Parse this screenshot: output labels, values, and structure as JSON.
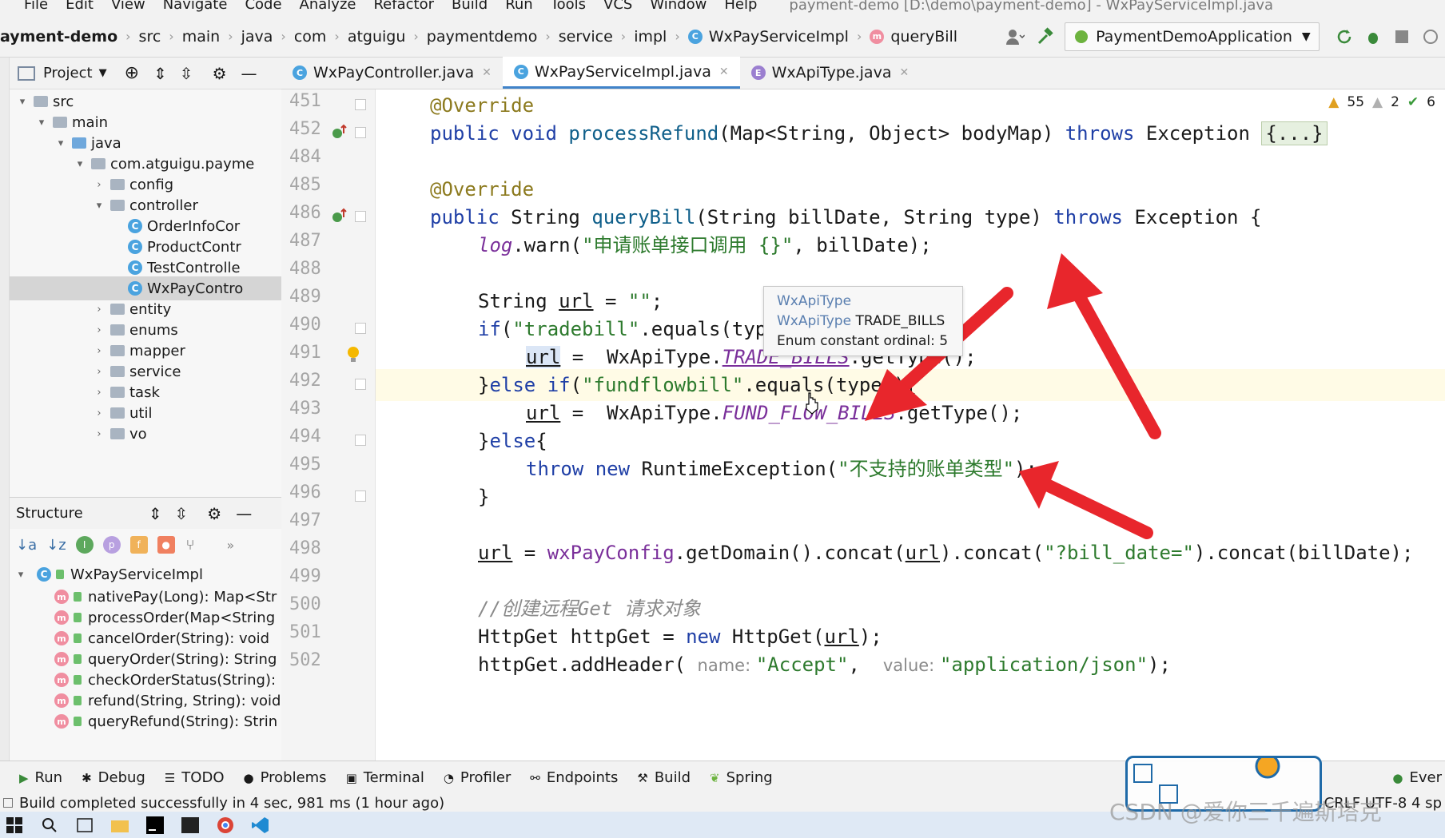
{
  "menu": [
    "File",
    "Edit",
    "View",
    "Navigate",
    "Code",
    "Analyze",
    "Refactor",
    "Build",
    "Run",
    "Tools",
    "VCS",
    "Window",
    "Help"
  ],
  "window_title": "payment-demo [D:\\demo\\payment-demo] - WxPayServiceImpl.java",
  "breadcrumb": [
    "ayment-demo",
    "src",
    "main",
    "java",
    "com",
    "atguigu",
    "paymentdemo",
    "service",
    "impl",
    "WxPayServiceImpl",
    "queryBill"
  ],
  "run_config": "PaymentDemoApplication",
  "project_panel": {
    "title": "Project",
    "tree": [
      {
        "label": "src",
        "depth": 1,
        "arrow": "▾",
        "kind": "folder"
      },
      {
        "label": "main",
        "depth": 2,
        "arrow": "▾",
        "kind": "folder"
      },
      {
        "label": "java",
        "depth": 3,
        "arrow": "▾",
        "kind": "folder-blue"
      },
      {
        "label": "com.atguigu.payme",
        "depth": 4,
        "arrow": "▾",
        "kind": "folder"
      },
      {
        "label": "config",
        "depth": 5,
        "arrow": "›",
        "kind": "folder"
      },
      {
        "label": "controller",
        "depth": 5,
        "arrow": "▾",
        "kind": "folder"
      },
      {
        "label": "OrderInfoCor",
        "depth": 6,
        "arrow": "",
        "kind": "class"
      },
      {
        "label": "ProductContr",
        "depth": 6,
        "arrow": "",
        "kind": "class"
      },
      {
        "label": "TestControlle",
        "depth": 6,
        "arrow": "",
        "kind": "class"
      },
      {
        "label": "WxPayContro",
        "depth": 6,
        "arrow": "",
        "kind": "class",
        "selected": true
      },
      {
        "label": "entity",
        "depth": 5,
        "arrow": "›",
        "kind": "folder"
      },
      {
        "label": "enums",
        "depth": 5,
        "arrow": "›",
        "kind": "folder"
      },
      {
        "label": "mapper",
        "depth": 5,
        "arrow": "›",
        "kind": "folder"
      },
      {
        "label": "service",
        "depth": 5,
        "arrow": "›",
        "kind": "folder"
      },
      {
        "label": "task",
        "depth": 5,
        "arrow": "›",
        "kind": "folder"
      },
      {
        "label": "util",
        "depth": 5,
        "arrow": "›",
        "kind": "folder"
      },
      {
        "label": "vo",
        "depth": 5,
        "arrow": "›",
        "kind": "folder"
      }
    ]
  },
  "structure_panel": {
    "title": "Structure",
    "root": "WxPayServiceImpl",
    "members": [
      "nativePay(Long): Map<Str",
      "processOrder(Map<String",
      "cancelOrder(String): void",
      "queryOrder(String): String",
      "checkOrderStatus(String):",
      "refund(String, String): void",
      "queryRefund(String): Strin"
    ]
  },
  "tabs": [
    {
      "label": "WxPayController.java",
      "icon": "C",
      "active": false
    },
    {
      "label": "WxPayServiceImpl.java",
      "icon": "C",
      "active": true
    },
    {
      "label": "WxApiType.java",
      "icon": "E",
      "active": false
    }
  ],
  "inspections": {
    "warnings": "55",
    "weak": "2",
    "ok": "6"
  },
  "line_numbers": [
    "451",
    "452",
    "484",
    "485",
    "486",
    "487",
    "488",
    "489",
    "490",
    "491",
    "492",
    "493",
    "494",
    "495",
    "496",
    "497",
    "498",
    "499",
    "500",
    "501",
    "502"
  ],
  "tooltip": {
    "line1": "WxApiType",
    "line2": "WxApiType TRADE_BILLS",
    "line3": "Enum constant ordinal: 5"
  },
  "code": {
    "l451": "@Override",
    "l452_kw": "public void ",
    "l452_fn": "processRefund",
    "l452_rest": "(Map<String, Object> bodyMap) ",
    "l452_throws": "throws",
    "l452_exc": " Exception ",
    "l452_fold": "{...}",
    "l485": "@Override",
    "l486_kw": "public ",
    "l486_type": "String ",
    "l486_fn": "queryBill",
    "l486_rest": "(String billDate, String type) ",
    "l486_throws": "throws",
    "l486_exc": " Exception {",
    "l487_log": "log",
    "l487_mid": ".warn(",
    "l487_str": "\"申请账单接口调用 {}\"",
    "l487_end": ", billDate);",
    "l489_a": "String ",
    "l489_var": "url",
    "l489_b": " = ",
    "l489_str": "\"\"",
    "l489_c": ";",
    "l490_kw": "if",
    "l490_a": "(",
    "l490_str": "\"tradebill\"",
    "l490_b": ".equals(type)){",
    "l491_var": "url",
    "l491_a": " =  WxApiType.",
    "l491_fld": "TRADE_BILLS",
    "l491_b": ".getType();",
    "l492_a": "}",
    "l492_kw": "else if",
    "l492_b": "(",
    "l492_str": "\"fundflowbill\"",
    "l492_c": ".equals(type)){",
    "l493_var": "url",
    "l493_a": " =  WxApiType.",
    "l493_fld": "FUND_FLOW_BILLS",
    "l493_b": ".getType();",
    "l494_a": "}",
    "l494_kw": "else",
    "l494_b": "{",
    "l495_kw": "throw new ",
    "l495_a": "RuntimeException(",
    "l495_str": "\"不支持的账单类型\"",
    "l495_b": ");",
    "l496": "}",
    "l498_var": "url",
    "l498_a": " = ",
    "l498_cfg": "wxPayConfig",
    "l498_b": ".getDomain().concat(",
    "l498_var2": "url",
    "l498_c": ").concat(",
    "l498_str": "\"?bill_date=\"",
    "l498_d": ").concat(billDate);",
    "l500": "//创建远程Get 请求对象",
    "l501_a": "HttpGet httpGet = ",
    "l501_kw": "new ",
    "l501_b": "HttpGet(",
    "l501_var": "url",
    "l501_c": ");",
    "l502_a": "httpGet.addHeader( ",
    "l502_h1": "name: ",
    "l502_s1": "\"Accept\"",
    "l502_b": ",  ",
    "l502_h2": "value: ",
    "l502_s2": "\"application/json\"",
    "l502_c": ");"
  },
  "bottom_tools": [
    "Run",
    "Debug",
    "TODO",
    "Problems",
    "Terminal",
    "Profiler",
    "Endpoints",
    "Build",
    "Spring"
  ],
  "bottom_right": "Ever",
  "status_text": "Build completed successfully in 4 sec, 981 ms (1 hour ago)",
  "status_right": "CRLF  UTF-8  4 sp",
  "watermark_text": "CSDN @爱你三千遍斯塔克",
  "colors": {
    "arrow_red": "#e8262c",
    "accent_blue": "#4083c9"
  }
}
